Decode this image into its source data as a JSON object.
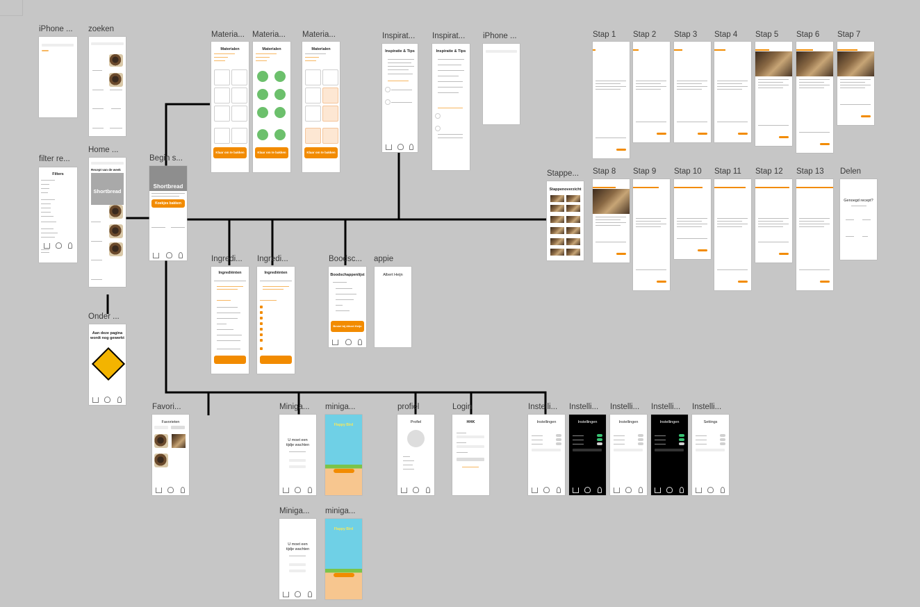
{
  "canvas": {
    "background": "#c6c6c6",
    "accent": "#f28b00",
    "line_color": "#000000"
  },
  "frames": {
    "iphone1": {
      "label": "iPhone ..."
    },
    "zoeken": {
      "label": "zoeken"
    },
    "filter": {
      "label": "filter re...",
      "title": "Filters"
    },
    "home": {
      "label": "Home ...",
      "heading": "Recept van de week",
      "banner": "Shortbread"
    },
    "onder": {
      "label": "Onder ...",
      "text1": "Aan deze pagina",
      "text2": "wordt nog gewerkt"
    },
    "begin": {
      "label": "Begin s...",
      "banner": "Shortbread",
      "button": "Koekjes bakken"
    },
    "materia1": {
      "label": "Materia...",
      "title": "Materialen",
      "button": "Klaar om te bakken"
    },
    "materia2": {
      "label": "Materia...",
      "title": "Materialen",
      "button": "Klaar om te bakken"
    },
    "materia3": {
      "label": "Materia...",
      "title": "Materialen",
      "button": "Klaar om te bakken"
    },
    "inspiratie1": {
      "label": "Inspirat...",
      "title": "Inspiratie & Tips"
    },
    "inspiratie2": {
      "label": "Inspirat...",
      "title": "Inspiratie & Tips"
    },
    "iphone2": {
      "label": "iPhone ..."
    },
    "ingredi1": {
      "label": "Ingredi...",
      "title": "Ingrediënten"
    },
    "ingredi2": {
      "label": "Ingredi...",
      "title": "Ingrediënten"
    },
    "boodsc": {
      "label": "Boodsc...",
      "title": "Boodschappenlijst",
      "button": "Bestel bij Albert Heijn"
    },
    "appie": {
      "label": "appie",
      "title": "Albert Heijn"
    },
    "stappen": {
      "label": "Stappe...",
      "title": "Stappenoverzicht"
    },
    "steps": [
      {
        "label": "Stap 1"
      },
      {
        "label": "Stap 2"
      },
      {
        "label": "Stap 3"
      },
      {
        "label": "Stap 4"
      },
      {
        "label": "Stap 5"
      },
      {
        "label": "Stap 6"
      },
      {
        "label": "Stap 7"
      },
      {
        "label": "Stap 8"
      },
      {
        "label": "Stap 9"
      },
      {
        "label": "Stap 10"
      },
      {
        "label": "Stap 11"
      },
      {
        "label": "Stap 12"
      },
      {
        "label": "Stap 13"
      }
    ],
    "delen": {
      "label": "Delen",
      "title": "Genoegd recept?"
    },
    "favori": {
      "label": "Favori...",
      "title": "Favorieten"
    },
    "miniga1": {
      "label": "Miniga...",
      "text1": "U moet een",
      "text2": "tijdje wachten"
    },
    "miniga2": {
      "label": "miniga...",
      "game": "Flappy Bird"
    },
    "miniga3": {
      "label": "Miniga...",
      "text1": "U moet een",
      "text2": "tijdje wachten"
    },
    "miniga4": {
      "label": "miniga...",
      "game": "Flappy Bird"
    },
    "profiel": {
      "label": "profiel",
      "title": "Profiel"
    },
    "login": {
      "label": "Login",
      "title": "HHK"
    },
    "instel1": {
      "label": "Instelli...",
      "title": "Instellingen"
    },
    "instel2": {
      "label": "Instelli...",
      "title": "Instellingen"
    },
    "instel3": {
      "label": "Instelli...",
      "title": "Instellingen"
    },
    "instel4": {
      "label": "Instelli...",
      "title": "Instellingen"
    },
    "instel5": {
      "label": "Instelli...",
      "title": "Settings"
    }
  }
}
